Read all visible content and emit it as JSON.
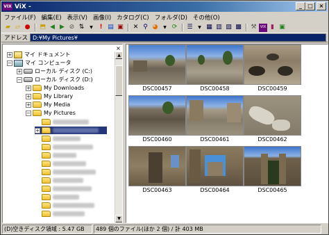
{
  "window": {
    "title": "ViX -"
  },
  "menu": [
    "ファイル(F)",
    "編集(E)",
    "表示(V)",
    "画像(I)",
    "カタログ(C)",
    "フォルダ(D)",
    "その他(O)"
  ],
  "address": {
    "label": "アドレス",
    "value": "D:¥My Pictures¥"
  },
  "tree": {
    "items": [
      {
        "label": "マイ ドキュメント"
      },
      {
        "label": "マイ コンピュータ"
      },
      {
        "label": "ローカル ディスク (C:)"
      },
      {
        "label": "ローカル ディスク (D:)"
      },
      {
        "label": "My Downloads"
      },
      {
        "label": "My Library"
      },
      {
        "label": "My Media"
      },
      {
        "label": "My Pictures"
      }
    ]
  },
  "thumbnails": [
    {
      "name": "DSC00457"
    },
    {
      "name": "DSC00458"
    },
    {
      "name": "DSC00459"
    },
    {
      "name": "DSC00460"
    },
    {
      "name": "DSC00461"
    },
    {
      "name": "DSC00462"
    },
    {
      "name": "DSC00463"
    },
    {
      "name": "DSC00464"
    },
    {
      "name": "DSC00465"
    }
  ],
  "status": {
    "free_space": "(D)空きディスク領域 : 5.47 GB",
    "file_count": "489 個のファイル(ほか 2 個) / 計 403 MB"
  }
}
